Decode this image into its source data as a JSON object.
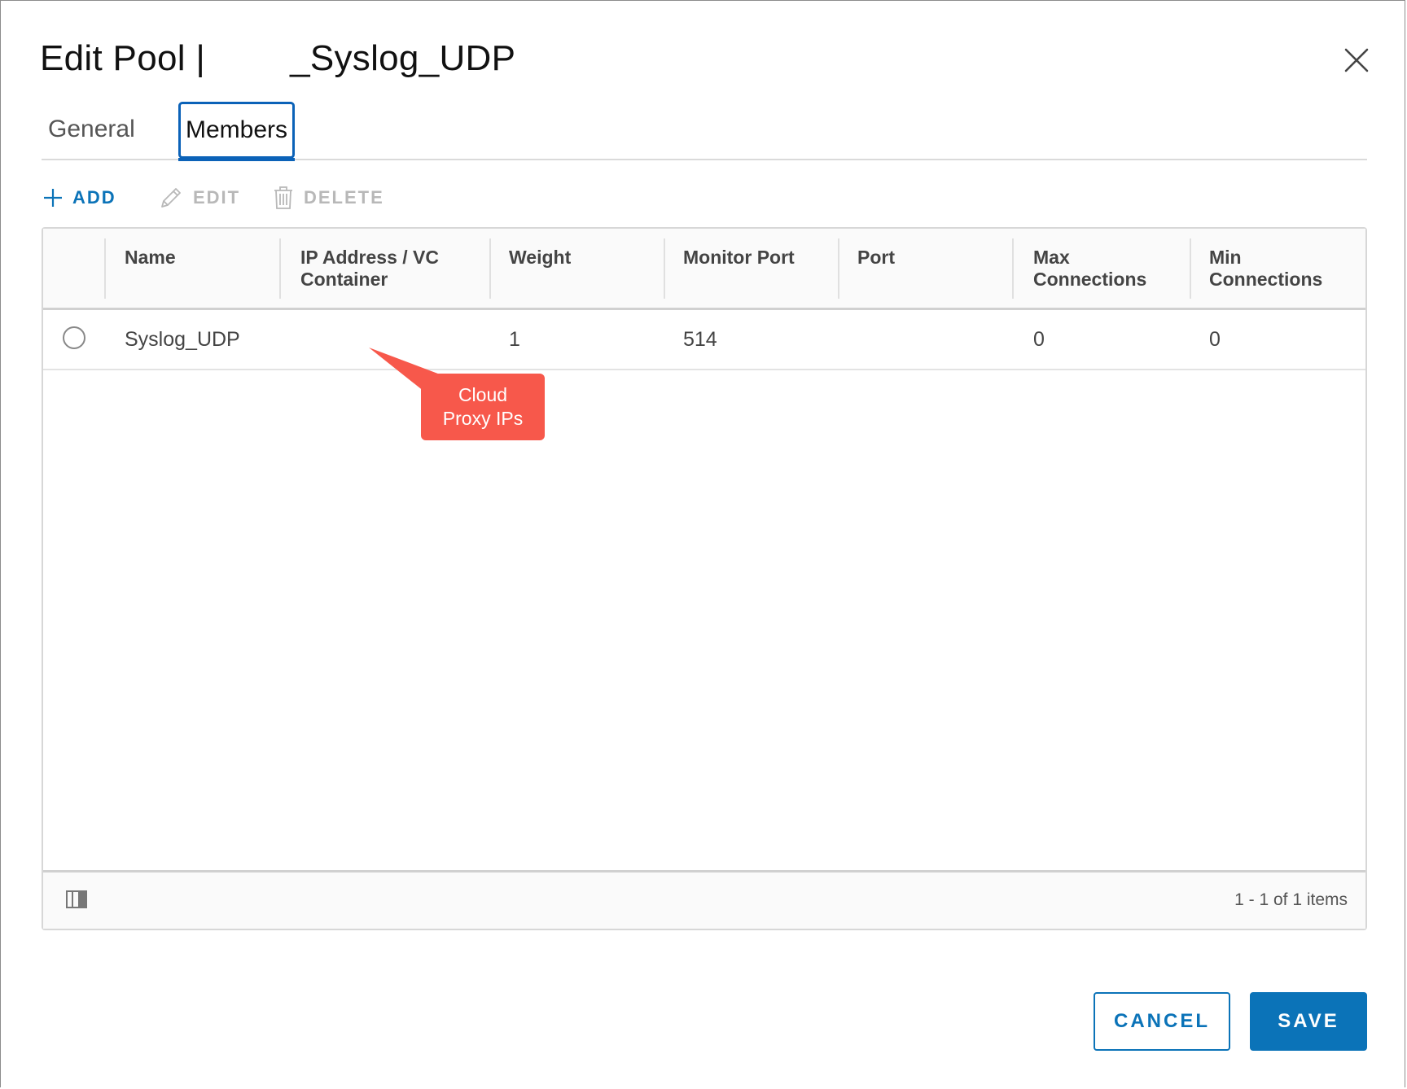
{
  "dialog": {
    "title_prefix": "Edit Pool |",
    "title_suffix": "_Syslog_UDP"
  },
  "tabs": [
    {
      "label": "General",
      "active": false
    },
    {
      "label": "Members",
      "active": true
    }
  ],
  "toolbar": {
    "add_label": "ADD",
    "edit_label": "EDIT",
    "delete_label": "DELETE"
  },
  "table": {
    "columns": [
      [
        "Name"
      ],
      [
        "IP Address / VC",
        "Container"
      ],
      [
        "Weight"
      ],
      [
        "Monitor Port"
      ],
      [
        "Port"
      ],
      [
        "Max",
        "Connections"
      ],
      [
        "Min",
        "Connections"
      ]
    ],
    "rows": [
      {
        "name": "Syslog_UDP",
        "ip": "",
        "weight": "1",
        "monitor_port": "514",
        "port": "",
        "max_connections": "0",
        "min_connections": "0"
      }
    ],
    "pagination": "1 - 1 of 1 items"
  },
  "callout": {
    "line1": "Cloud",
    "line2": "Proxy IPs",
    "color": "#f7584b"
  },
  "footer": {
    "cancel_label": "CANCEL",
    "save_label": "SAVE"
  },
  "colors": {
    "accent": "#0b73b8",
    "disabled": "#b8b8b8"
  }
}
